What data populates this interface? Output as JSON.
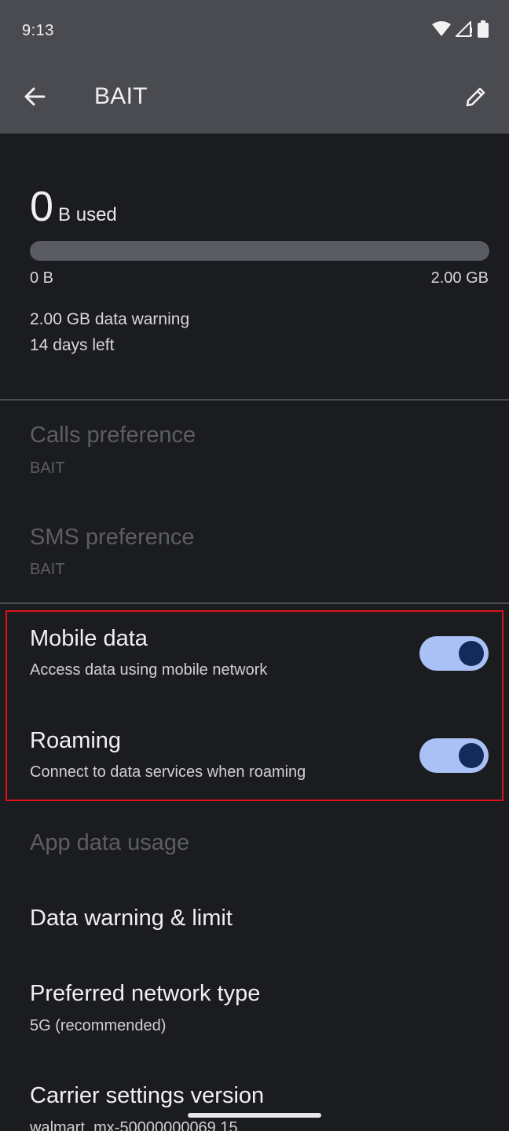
{
  "status_bar": {
    "time": "9:13"
  },
  "app_bar": {
    "title": "BAIT"
  },
  "usage": {
    "amount": "0",
    "unit": "B used",
    "used_fraction": 0.0,
    "range_min": "0 B",
    "range_max": "2.00 GB",
    "warning": "2.00 GB data warning",
    "days_left": "14 days left"
  },
  "preferences": [
    {
      "title": "Calls preference",
      "value": "BAIT"
    },
    {
      "title": "SMS preference",
      "value": "BAIT"
    }
  ],
  "toggles": {
    "mobile_data": {
      "title": "Mobile data",
      "subtitle": "Access data using mobile network",
      "on": true
    },
    "roaming": {
      "title": "Roaming",
      "subtitle": "Connect to data services when roaming",
      "on": true
    }
  },
  "items": {
    "app_data_usage": {
      "title": "App data usage"
    },
    "data_warning_limit": {
      "title": "Data warning & limit"
    },
    "preferred_network": {
      "title": "Preferred network type",
      "value": "5G (recommended)"
    },
    "carrier_settings": {
      "title": "Carrier settings version",
      "value": "walmart_mx-50000000069.15"
    }
  },
  "colors": {
    "accent": "#a9c1f5",
    "knob": "#142a5a",
    "highlight": "#e0101a",
    "app_bar_bg": "#4a4b50",
    "page_bg": "#1b1c20"
  }
}
